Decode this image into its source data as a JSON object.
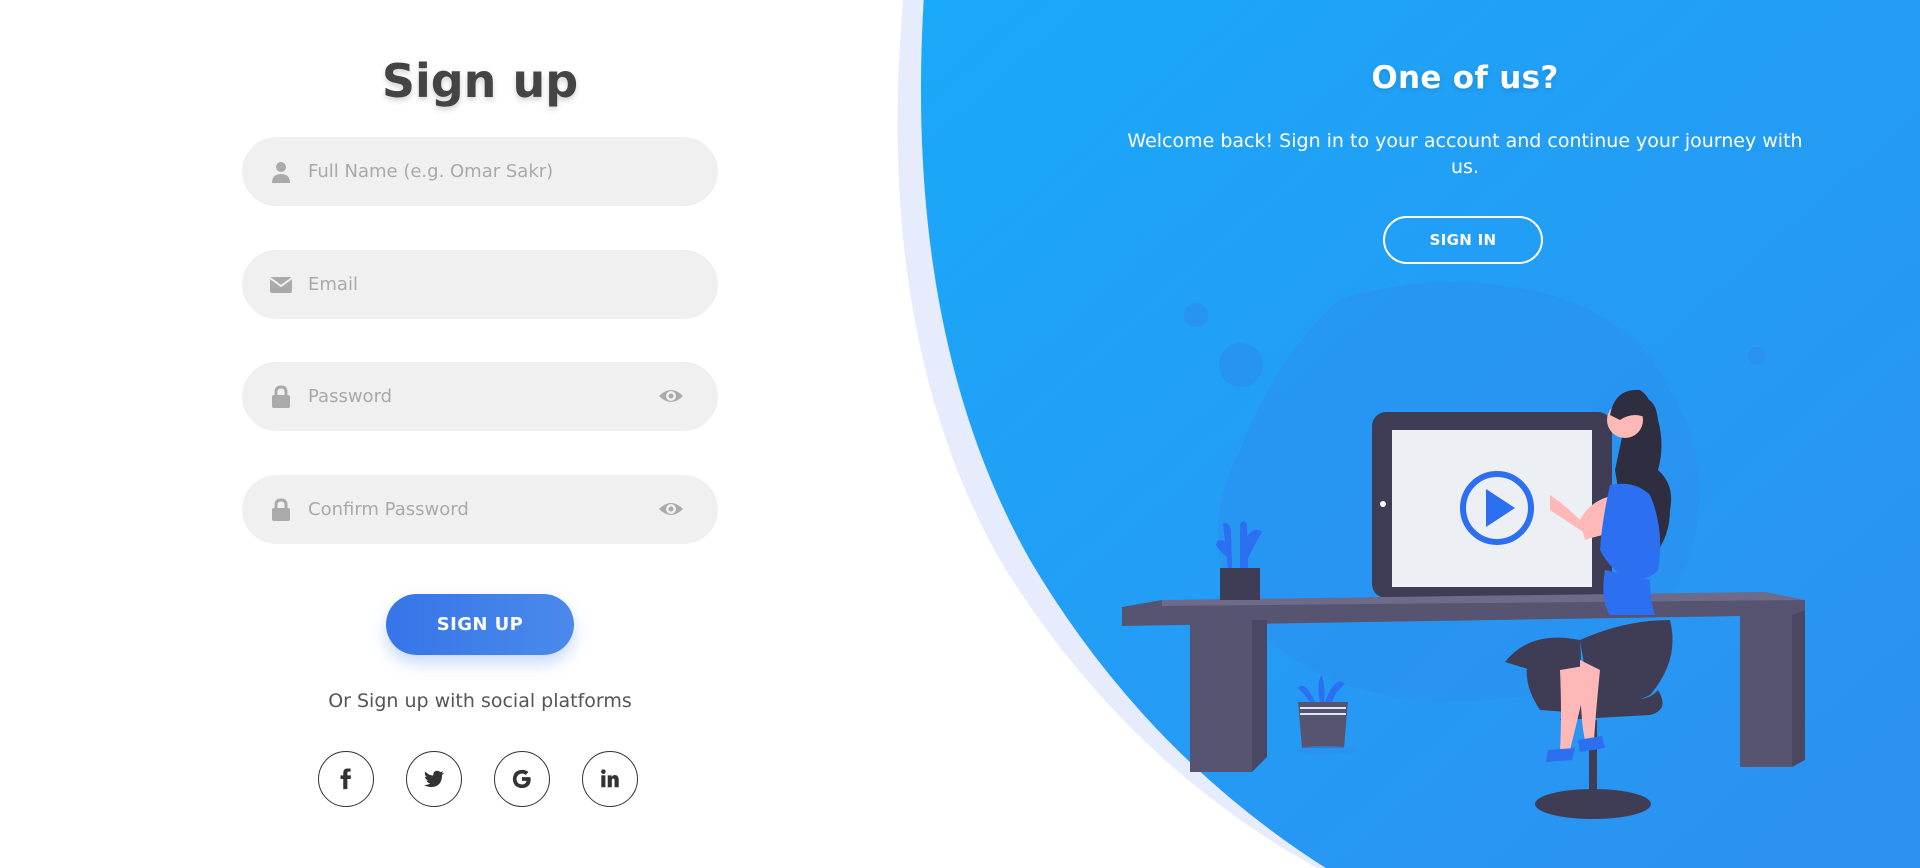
{
  "signup": {
    "title": "Sign up",
    "fields": [
      {
        "placeholder": "Full Name (e.g. Omar Sakr)",
        "value": "",
        "icon": "user-icon"
      },
      {
        "placeholder": "Email",
        "value": "",
        "icon": "envelope-icon"
      },
      {
        "placeholder": "Password",
        "value": "",
        "icon": "lock-icon",
        "toggle": "eye-icon"
      },
      {
        "placeholder": "Confirm Password",
        "value": "",
        "icon": "lock-icon",
        "toggle": "eye-icon"
      }
    ],
    "submit_label": "SIGN UP",
    "social_text": "Or Sign up with social platforms",
    "social_icons": [
      "facebook-icon",
      "twitter-icon",
      "google-icon",
      "linkedin-icon"
    ]
  },
  "panel": {
    "title": "One of us?",
    "text": "Welcome back! Sign in to your account and continue your journey with us.",
    "button_label": "SIGN IN"
  },
  "colors": {
    "accent_blue": "#1da6f8",
    "accent_blue_dark": "#2a92f0",
    "button_blue": "#3b7ee9",
    "input_bg": "#f0f0f0",
    "title_text": "#444444",
    "placeholder": "#a9a9a9"
  }
}
